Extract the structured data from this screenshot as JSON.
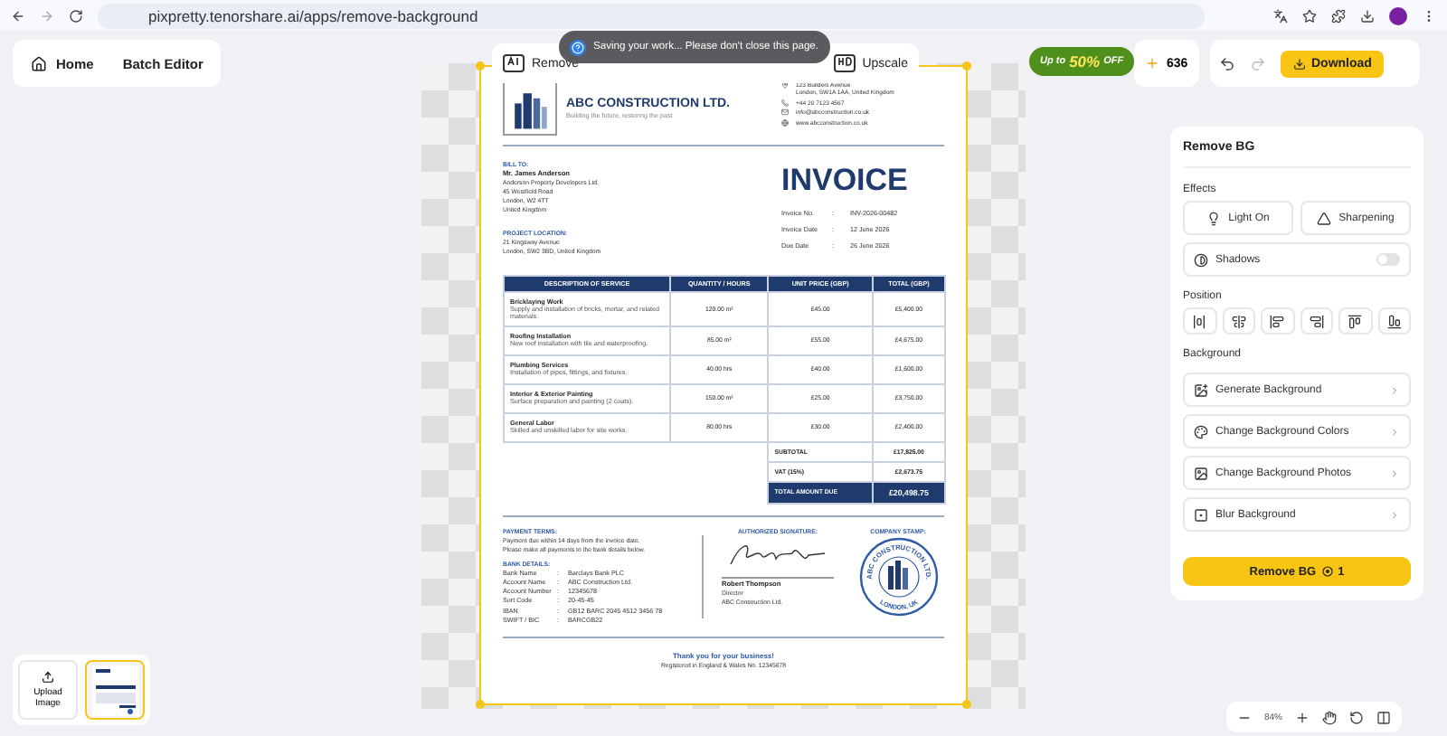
{
  "browser": {
    "url": "pixpretty.tenorshare.ai/apps/remove-background"
  },
  "nav": [
    "Home",
    "Batch Editor"
  ],
  "tools": [
    {
      "label": "Remove",
      "kind": "ai"
    },
    {
      "label": "Upscale",
      "kind": "hd"
    }
  ],
  "toast": "Saving your work... Please don't close this page.",
  "promo": {
    "prefix": "Up to",
    "highlight": "50%",
    "suffix": "OFF"
  },
  "credits": "636",
  "download": "Download",
  "invoice": {
    "company": "ABC CONSTRUCTION LTD.",
    "tagline": "Building the future, restoring the past",
    "contact": [
      {
        "kind": "address",
        "lines": [
          "123 Builders Avenue",
          "London, SW1A 1AA, United Kingdom"
        ]
      },
      {
        "kind": "phone",
        "lines": [
          "+44 20 7123 4567"
        ]
      },
      {
        "kind": "email",
        "lines": [
          "info@abcconstruction.co.uk"
        ]
      },
      {
        "kind": "web",
        "lines": [
          "www.abcconstruction.co.uk"
        ]
      }
    ],
    "title": "INVOICE",
    "bill_to_label": "BILL TO:",
    "bill_to_name": "Mr. James Anderson",
    "bill_to_lines": [
      "Anderson Property Developers Ltd.",
      "45 Westfield Road",
      "London, W2 4TT",
      "United Kingdom"
    ],
    "meta": [
      {
        "label": "Invoice No.",
        "colon": ":",
        "value": "INV-2026-00482"
      },
      {
        "label": "Invoice Date",
        "colon": ":",
        "value": "12 June 2026"
      },
      {
        "label": "Due Date",
        "colon": ":",
        "value": "26 June 2026"
      }
    ],
    "project_label": "PROJECT LOCATION:",
    "project_lines": [
      "21 Kingsway Avenue",
      "London, SW2 3BD, United Kingdom"
    ],
    "columns": [
      "DESCRIPTION OF SERVICE",
      "QUANTITY / HOURS",
      "UNIT PRICE (GBP)",
      "TOTAL (GBP)"
    ],
    "rows": [
      {
        "title": "Bricklaying Work",
        "desc": "Supply and installation of bricks, mortar, and related materials.",
        "qty": "120.00 m²",
        "unit": "£45.00",
        "total": "£5,400.00"
      },
      {
        "title": "Roofing Installation",
        "desc": "New roof installation with tile and waterproofing.",
        "qty": "85.00 m²",
        "unit": "£55.00",
        "total": "£4,675.00"
      },
      {
        "title": "Plumbing Services",
        "desc": "Installation of pipes, fittings, and fixtures.",
        "qty": "40.00 hrs",
        "unit": "£40.00",
        "total": "£1,600.00"
      },
      {
        "title": "Interior & Exterior Painting",
        "desc": "Surface preparation and painting (2 coats).",
        "qty": "150.00 m²",
        "unit": "£25.00",
        "total": "£3,750.00"
      },
      {
        "title": "General Labor",
        "desc": "Skilled and unskilled labor for site works.",
        "qty": "80.00 hrs",
        "unit": "£30.00",
        "total": "£2,400.00"
      }
    ],
    "totals": [
      {
        "label": "SUBTOTAL",
        "value": "£17,825.00",
        "highlight": false
      },
      {
        "label": "VAT (15%)",
        "value": "£2,673.75",
        "highlight": false
      },
      {
        "label": "TOTAL AMOUNT DUE",
        "value": "£20,498.75",
        "highlight": true
      }
    ],
    "payment_label": "PAYMENT TERMS:",
    "payment_lines": [
      "Payment due within 14 days from the invoice date.",
      "Please make all payments to the bank details below."
    ],
    "bank_label": "BANK DETAILS:",
    "bank": [
      {
        "label": "Bank Name",
        "colon": ":",
        "value": "Barclays Bank PLC"
      },
      {
        "label": "Account Name",
        "colon": ":",
        "value": "ABC Construction Ltd."
      },
      {
        "label": "Account Number",
        "colon": ":",
        "value": "12345678"
      },
      {
        "label": "Sort Code",
        "colon": ":",
        "value": "20-45-45"
      },
      {
        "label": "IBAN",
        "colon": ":",
        "value": "GB12 BARC 2045 4512 3456 78"
      },
      {
        "label": "SWIFT / BIC",
        "colon": ":",
        "value": "BARCGB22"
      }
    ],
    "signature_label": "AUTHORIZED SIGNATURE:",
    "signer": "Robert Thompson",
    "signer_role": "Director",
    "signer_company": "ABC Construction Ltd.",
    "stamp_label": "COMPANY STAMP:",
    "stamp_ring": "ABC CONSTRUCTION LTD.",
    "stamp_bottom": "LONDON, UK",
    "thanks": "Thank you for your business!",
    "registered": "Registered in England & Wales No. 12345678"
  },
  "panel": {
    "title": "Remove BG",
    "effects_label": "Effects",
    "effects": [
      {
        "label": "Light On",
        "kind": "light"
      },
      {
        "label": "Sharpening",
        "kind": "sharpen"
      }
    ],
    "shadows": {
      "label": "Shadows",
      "on": false
    },
    "position_label": "Position",
    "background_label": "Background",
    "backgrounds": [
      {
        "label": "Generate Background",
        "kind": "generate"
      },
      {
        "label": "Change Background Colors",
        "kind": "colors"
      },
      {
        "label": "Change Background Photos",
        "kind": "photos"
      },
      {
        "label": "Blur Background",
        "kind": "blur"
      }
    ],
    "action": "Remove BG",
    "action_cost": "1"
  },
  "zoom": "84%",
  "tray": {
    "upload": "Upload Image",
    "thumbnail_selected": true
  }
}
